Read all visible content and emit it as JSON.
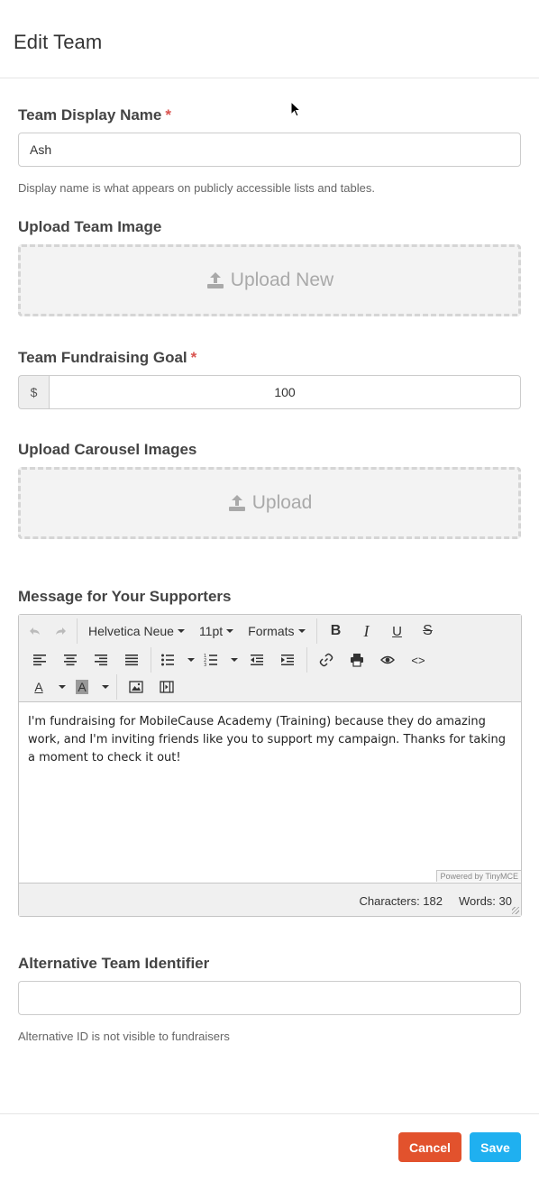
{
  "modal": {
    "title": "Edit Team"
  },
  "display_name": {
    "label": "Team Display Name",
    "required_mark": "*",
    "value": "Ash",
    "help": "Display name is what appears on publicly accessible lists and tables."
  },
  "team_image": {
    "label": "Upload Team Image",
    "button_label": "Upload New",
    "icon": "upload-icon"
  },
  "goal": {
    "label": "Team Fundraising Goal",
    "required_mark": "*",
    "currency_symbol": "$",
    "value": "100"
  },
  "carousel": {
    "label": "Upload Carousel Images",
    "button_label": "Upload",
    "icon": "upload-icon"
  },
  "message": {
    "label": "Message for Your Supporters",
    "toolbar": {
      "font_family": "Helvetica Neue",
      "font_size": "11pt",
      "formats": "Formats",
      "bold": "B",
      "italic": "I",
      "underline": "U",
      "strike": "S",
      "text_color": "A",
      "bg_color": "A",
      "code": "<>"
    },
    "content": "I'm fundraising for MobileCause Academy (Training) because they do amazing work, and I'm inviting friends like you to support my campaign. Thanks for taking a moment to check it out!",
    "powered_by": "Powered by TinyMCE",
    "characters": "Characters: 182",
    "words": "Words: 30"
  },
  "alt_identifier": {
    "label": "Alternative Team Identifier",
    "value": "",
    "help": "Alternative ID is not visible to fundraisers"
  },
  "footer": {
    "cancel_label": "Cancel",
    "save_label": "Save"
  },
  "colors": {
    "cancel": "#e2522d",
    "save": "#1fb0f0",
    "required": "#d9534f"
  }
}
